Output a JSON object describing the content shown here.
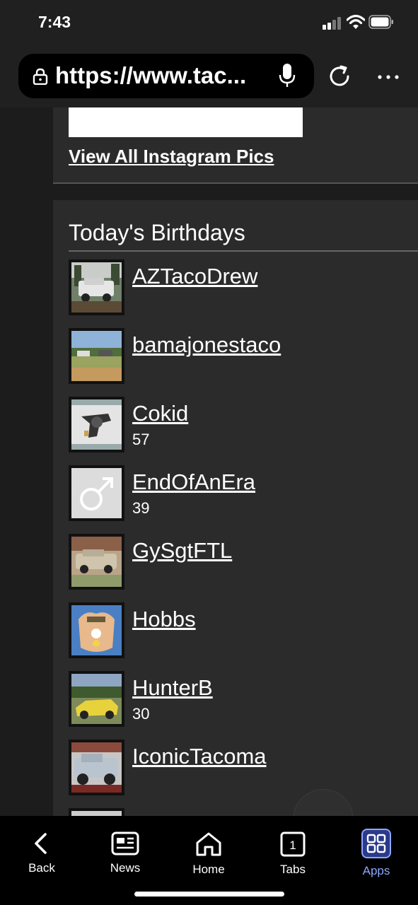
{
  "status_bar": {
    "time": "7:43"
  },
  "browser": {
    "url": "https://www.tac..."
  },
  "instagram": {
    "link_label": "View All Instagram Pics"
  },
  "birthdays": {
    "title": "Today's Birthdays",
    "items": [
      {
        "name": "AZTacoDrew",
        "age": ""
      },
      {
        "name": "bamajonestaco",
        "age": ""
      },
      {
        "name": "Cokid",
        "age": "57"
      },
      {
        "name": "EndOfAnEra",
        "age": "39"
      },
      {
        "name": "GySgtFTL",
        "age": ""
      },
      {
        "name": "Hobbs",
        "age": ""
      },
      {
        "name": "HunterB",
        "age": "30"
      },
      {
        "name": "IconicTacoma",
        "age": ""
      }
    ]
  },
  "toolbar": {
    "back": "Back",
    "news": "News",
    "home": "Home",
    "tabs": "Tabs",
    "tabs_count": "1",
    "apps": "Apps"
  },
  "colors": {
    "accent": "#8ea7ff",
    "panel": "#2b2b2b",
    "background": "#1c1c1c"
  }
}
